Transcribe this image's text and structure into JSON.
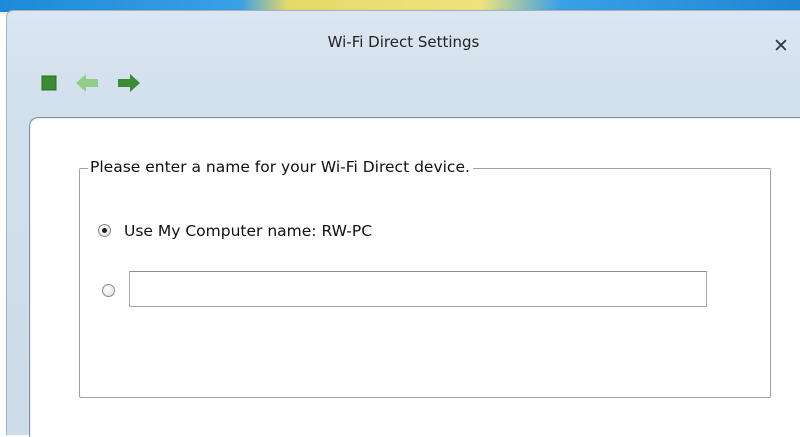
{
  "window": {
    "title": "Wi-Fi Direct Settings",
    "close_glyph": "✕"
  },
  "toolbar": {
    "buttons": [
      {
        "icon": "stop-icon",
        "color": "#3d8a35"
      },
      {
        "icon": "back-arrow-icon",
        "color": "#8fcf87"
      },
      {
        "icon": "forward-arrow-icon",
        "color": "#3d8a35"
      }
    ]
  },
  "form": {
    "group_label": "Please enter a name for your Wi-Fi Direct device.",
    "option_computer_name": {
      "label": "Use My Computer name: RW-PC",
      "checked": true
    },
    "option_custom_name": {
      "checked": false,
      "value": "",
      "placeholder": ""
    }
  }
}
